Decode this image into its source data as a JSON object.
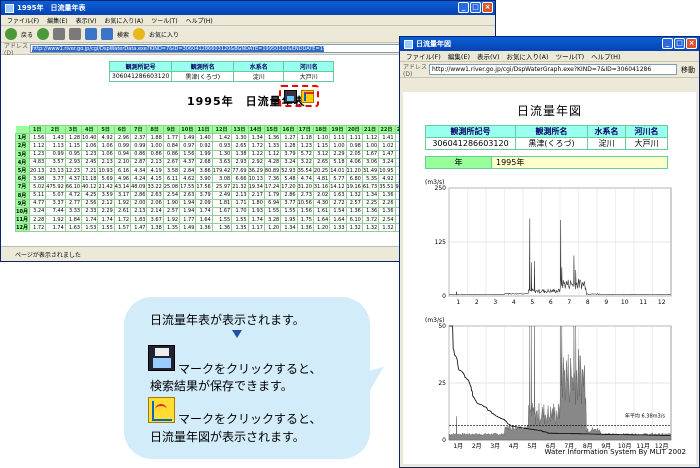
{
  "win1": {
    "title": "1995年　日流量年表",
    "menu": [
      "ファイル(F)",
      "編集(E)",
      "表示(V)",
      "お気に入り(A)",
      "ツール(T)",
      "ヘルプ(H)"
    ],
    "toolbar": {
      "back": "戻る",
      "search": "検索",
      "favorites": "お気に入り"
    },
    "address_label": "アドレス(D)",
    "url": "http://www1.river.go.jp/cgi/DspWaterData.exe?KIND=7&ID=306041286603120&BGNDATE=19950101&ENDDATE=19951231",
    "header_labels": [
      "観測所記号",
      "観測所名",
      "水系名",
      "河川名"
    ],
    "header_values": [
      "306041286603120",
      "黒津(くろづ)",
      "淀川",
      "大戸川"
    ],
    "day_labels": [
      "1日",
      "2日",
      "3日",
      "4日",
      "5日",
      "6日",
      "7日",
      "8日",
      "9日",
      "10日",
      "11日",
      "12日",
      "13日",
      "14日",
      "15日",
      "16日",
      "17日",
      "18日",
      "19日",
      "20日",
      "21日",
      "22日",
      "23日",
      "24日",
      "25日"
    ],
    "rows": [
      {
        "m": "1月",
        "v": [
          "1.56",
          "1.43",
          "1.28",
          "10.40",
          "4.92",
          "2.96",
          "2.37",
          "1.88",
          "1.77",
          "1.49",
          "1.40",
          "1.42",
          "1.30",
          "1.34",
          "1.36",
          "1.27",
          "1.18",
          "1.10",
          "1.11",
          "1.11",
          "1.12",
          "1.41",
          "1.76",
          "1.36",
          "1.13"
        ]
      },
      {
        "m": "2月",
        "v": [
          "1.12",
          "1.13",
          "1.15",
          "1.06",
          "1.06",
          "0.99",
          "0.99",
          "1.00",
          "0.84",
          "0.97",
          "0.92",
          "0.93",
          "2.65",
          "1.72",
          "1.33",
          "1.28",
          "1.23",
          "1.15",
          "1.00",
          "0.98",
          "1.00",
          "1.02",
          "0.92",
          "0.87",
          "0.87"
        ]
      },
      {
        "m": "3月",
        "v": [
          "1.23",
          "0.99",
          "0.95",
          "1.23",
          "1.06",
          "0.94",
          "0.86",
          "0.86",
          "0.86",
          "1.56",
          "1.99",
          "1.30",
          "1.38",
          "1.22",
          "1.12",
          "3.79",
          "5.72",
          "3.12",
          "2.29",
          "2.05",
          "1.67",
          "1.47",
          "1.41",
          "1.43",
          "1.62"
        ]
      },
      {
        "m": "4月",
        "v": [
          "4.83",
          "3.57",
          "2.93",
          "2.45",
          "2.13",
          "2.10",
          "2.87",
          "2.13",
          "2.67",
          "4.37",
          "2.68",
          "3.63",
          "2.93",
          "2.92",
          "4.28",
          "3.24",
          "3.22",
          "2.65",
          "5.18",
          "4.06",
          "3.06",
          "3.24",
          "4.26",
          "4.97",
          "3.82"
        ]
      },
      {
        "m": "5月",
        "v": [
          "20.13",
          "23.13",
          "12.23",
          "7.21",
          "10.93",
          "6.16",
          "4.34",
          "4.19",
          "3.58",
          "2.84",
          "3.86",
          "179.42",
          "77.69",
          "36.29",
          "80.89",
          "52.93",
          "35.54",
          "20.25",
          "14.01",
          "11.20",
          "31.49",
          "10.95",
          "7.76",
          "6.53",
          "6.53"
        ]
      },
      {
        "m": "6月",
        "v": [
          "3.98",
          "3.77",
          "4.37",
          "11.18",
          "5.69",
          "4.96",
          "4.24",
          "4.15",
          "6.11",
          "4.62",
          "3.90",
          "3.08",
          "6.66",
          "10.13",
          "7.36",
          "5.48",
          "4.74",
          "4.81",
          "5.77",
          "6.80",
          "5.35",
          "4.92",
          "4.48",
          "4.03",
          "3.78"
        ]
      },
      {
        "m": "7月",
        "v": [
          "5.02",
          "475.92",
          "66.10",
          "40.12",
          "21.42",
          "43.14",
          "48.09",
          "33.22",
          "25.08",
          "17.55",
          "17.56",
          "25.97",
          "21.32",
          "19.34",
          "17.24",
          "17.20",
          "31.20",
          "31.16",
          "14.12",
          "19.16",
          "61.73",
          "35.51",
          "93.65",
          "60.24",
          "54.59",
          "55.34",
          "17.10"
        ]
      },
      {
        "m": "8月",
        "v": [
          "5.11",
          "5.07",
          "4.72",
          "4.25",
          "3.59",
          "3.17",
          "2.86",
          "2.63",
          "2.54",
          "2.63",
          "3.79",
          "2.49",
          "2.13",
          "2.17",
          "1.79",
          "2.86",
          "2.73",
          "2.02",
          "1.63",
          "1.32",
          "1.34",
          "1.36",
          "1.35",
          "1.36",
          "1.57"
        ]
      },
      {
        "m": "9月",
        "v": [
          "4.77",
          "3.37",
          "2.77",
          "2.56",
          "2.12",
          "1.92",
          "2.00",
          "2.06",
          "1.90",
          "1.94",
          "2.09",
          "1.81",
          "1.71",
          "1.80",
          "6.94",
          "3.77",
          "10.56",
          "4.30",
          "2.72",
          "2.57",
          "2.25",
          "2.26",
          "2.18",
          "2.14",
          "2.33"
        ]
      },
      {
        "m": "10月",
        "v": [
          "3.24",
          "7.44",
          "3.33",
          "2.33",
          "2.29",
          "2.61",
          "2.13",
          "2.14",
          "2.57",
          "1.94",
          "1.74",
          "1.67",
          "1.70",
          "1.93",
          "1.55",
          "1.55",
          "1.56",
          "1.61",
          "1.54",
          "1.36",
          "1.36",
          "1.36",
          "1.35",
          "1.17",
          "6.75"
        ]
      },
      {
        "m": "11月",
        "v": [
          "2.28",
          "1.92",
          "1.84",
          "1.74",
          "1.74",
          "1.72",
          "1.83",
          "3.67",
          "1.92",
          "1.77",
          "1.64",
          "1.55",
          "1.55",
          "1.74",
          "3.28",
          "1.95",
          "1.75",
          "1.64",
          "1.64",
          "6.10",
          "3.72",
          "2.54",
          "2.22",
          "2.10",
          "2.10"
        ]
      },
      {
        "m": "12月",
        "v": [
          "1.72",
          "1.74",
          "1.63",
          "1.53",
          "1.55",
          "1.57",
          "1.47",
          "1.38",
          "1.35",
          "1.49",
          "1.36",
          "1.36",
          "1.35",
          "1.17",
          "1.20",
          "1.34",
          "1.36",
          "1.20",
          "1.33",
          "1.32",
          "1.32",
          "1.32",
          "1.34",
          "1.34",
          "1.34"
        ]
      }
    ],
    "status": "ページが表示されました"
  },
  "win2": {
    "title": "日流量年図",
    "menu": [
      "ファイル(F)",
      "編集(E)",
      "表示(V)",
      "お気に入り(A)",
      "ツール(T)",
      "ヘルプ(H)"
    ],
    "address_label": "アドレス(D)",
    "url": "http://www1.river.go.jp/cgi/DspWaterGraph.exe?KIND=7&ID=306041286",
    "go_label": "移動",
    "header_labels": [
      "観測所記号",
      "観測所名",
      "水系名",
      "河川名"
    ],
    "header_values": [
      "306041286603120",
      "黒津(くろづ)",
      "淀川",
      "大戸川"
    ],
    "year_label": "年",
    "year_value": "1995年",
    "footer": "Water Information System By MLIT 2002"
  },
  "chart_data": [
    {
      "type": "line",
      "ylabel": "(m3/s)",
      "ylim": [
        0,
        250
      ],
      "yticks": [
        "250",
        "125",
        "0"
      ],
      "xticks": [
        "1",
        "2",
        "3",
        "4",
        "5",
        "6",
        "7",
        "8",
        "9",
        "10",
        "11",
        "12"
      ],
      "peaks": [
        [
          0.4,
          10.4
        ],
        [
          4.37,
          179.42
        ],
        [
          4.45,
          77.69
        ],
        [
          4.62,
          80.89
        ],
        [
          6.04,
          175.92
        ],
        [
          6.1,
          66.1
        ],
        [
          6.75,
          93.65
        ],
        [
          6.85,
          60.24
        ]
      ],
      "baseline": 3
    },
    {
      "type": "area",
      "ylabel": "(m3/s)",
      "ylim": [
        0,
        50
      ],
      "yticks": [
        "50",
        "25",
        "0"
      ],
      "xticks": [
        "1月",
        "2月",
        "3月",
        "4月",
        "5月",
        "6月",
        "7月",
        "8月",
        "9月",
        "10月",
        "11月",
        "12月"
      ],
      "annotation": "年平均 6.38m3/s",
      "mean": 6.38
    }
  ],
  "callout": {
    "line1": "日流量年表が表示されます。",
    "line2": "マークをクリックすると、",
    "line3": "検索結果が保存できます。",
    "line4": "マークをクリックすると、",
    "line5": "日流量年図が表示されます。"
  }
}
